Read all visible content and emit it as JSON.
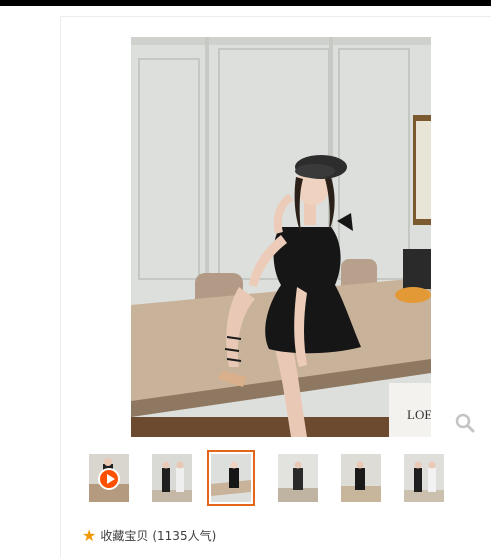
{
  "favorite": {
    "label": "收藏宝贝",
    "count": "(1135人气)"
  },
  "thumbnails": [
    {
      "name": "thumb-1",
      "has_video": true
    },
    {
      "name": "thumb-2",
      "has_video": false
    },
    {
      "name": "thumb-3",
      "has_video": false,
      "selected": true
    },
    {
      "name": "thumb-4",
      "has_video": false
    },
    {
      "name": "thumb-5",
      "has_video": false
    },
    {
      "name": "thumb-6",
      "has_video": false
    }
  ],
  "colors": {
    "accent": "#e4661a",
    "play_badge": "#ff5000",
    "star": "#f39800"
  },
  "icons": {
    "zoom": "magnifier-icon",
    "play": "play-icon",
    "star": "star-icon"
  }
}
